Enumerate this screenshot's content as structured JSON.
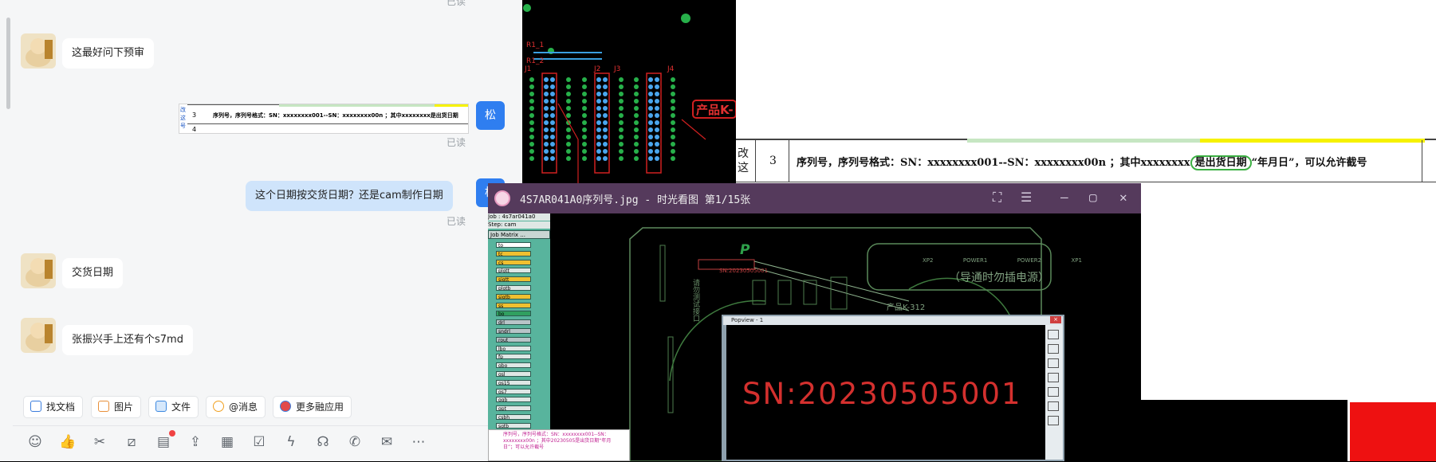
{
  "chat": {
    "top_read": "已读",
    "messages": [
      {
        "text": "这最好问下预审",
        "side": "left"
      },
      {
        "image": true,
        "read": "已读",
        "avatar_text": "松",
        "side": "right"
      },
      {
        "text": "这个日期按交货日期？还是cam制作日期",
        "read": "已读",
        "avatar_text": "松",
        "side": "right"
      },
      {
        "text": "交货日期",
        "side": "left"
      },
      {
        "text": "张振兴手上还有个s7md",
        "side": "left"
      }
    ],
    "thumb": {
      "side_chars": "改 这 号",
      "row_num": "3",
      "row_text": "序列号，序列号格式：SN：xxxxxxxx001--SN：xxxxxxxx00n ；其中xxxxxxxx是出货日期",
      "row_num2": "4"
    }
  },
  "toolbar": {
    "buttons": [
      {
        "label": "找文档",
        "icon": "doc-search-icon"
      },
      {
        "label": "图片",
        "icon": "image-icon"
      },
      {
        "label": "文件",
        "icon": "folder-icon"
      },
      {
        "label": "@消息",
        "icon": "at-icon"
      },
      {
        "label": "更多融应用",
        "icon": "apps-icon"
      }
    ],
    "icons": [
      "emoji-icon",
      "thumbs-up-icon",
      "scissors-icon",
      "slash-command-icon",
      "doc-add-icon",
      "upload-icon",
      "calendar-icon",
      "checkbox-icon",
      "lightning-icon",
      "headset-icon",
      "phone-icon",
      "mail-icon",
      "more-icon"
    ]
  },
  "pcb_top": {
    "labels": [
      "R1_1",
      "R1_2",
      "J1",
      "J2",
      "J3",
      "J4",
      "产品K-"
    ]
  },
  "doc_bg": {
    "left_chars": "改 这",
    "row_num": "3",
    "row_text_a": "序列号，序列号格式：SN：xxxxxxxx001--SN：xxxxxxxx00n ；其中xxxxxxxx",
    "row_text_b": "是出货日期",
    "row_text_c": "“年月日”，可以允许截号",
    "accent": "#f6f200"
  },
  "viewer": {
    "title": "4S7AR041A0序列号.jpg - 时光看图 第1/15张",
    "job_line": "Job : 4s7ar041a0",
    "step_line": "Step: cam",
    "matrix_label": "Job Matrix ...",
    "layers": [
      "to",
      "tc",
      "cs",
      "plgtt",
      "sigtt",
      "plgtb",
      "sigtb",
      "ss",
      "bo",
      "drl",
      "sndrl",
      "rout",
      "lbo",
      "fp",
      "gbo",
      "gsl",
      "gs15",
      "gs7",
      "ggb",
      "gpt",
      "csbh",
      "sgtb",
      "hannbu",
      "dkst",
      "dksb"
    ],
    "board_sn": "SN:20230505001",
    "board_label_top": "导通时勿插电源",
    "board_label_prod": "产品K-312",
    "board_connectors": [
      "XP2",
      "POWER1",
      "POWER2",
      "XP1"
    ],
    "board_side_text": "请勿测试接口",
    "board_p": "P",
    "board_digit": "9",
    "note_text": "序列号，序列号格式：SN：xxxxxxxx001--SN：xxxxxxxx00n ；其中20230505是出货日期“年月日”；可以允许截号",
    "popview_title": "Popview - 1",
    "popview_sn": "SN:20230505001",
    "sn_color": "#d4302e"
  }
}
